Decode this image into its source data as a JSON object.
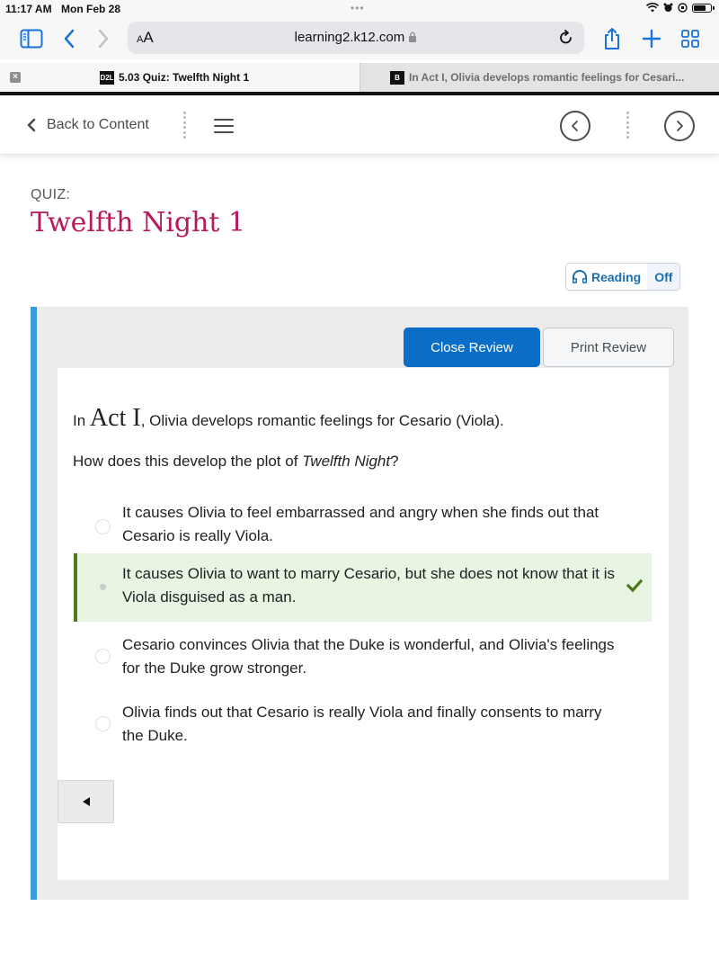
{
  "status_bar": {
    "time": "11:17 AM",
    "date": "Mon Feb 28",
    "dots": "•••"
  },
  "browser": {
    "text_size_small": "A",
    "text_size_large": "A",
    "url": "learning2.k12.com",
    "lock_icon": "🔒",
    "tabs": [
      {
        "favicon": "D2L",
        "title": "5.03 Quiz: Twelfth Night 1",
        "active": true
      },
      {
        "favicon": "B",
        "title": "In Act I, Olivia develops romantic feelings for Cesari...",
        "active": false
      }
    ],
    "tab_close": "×"
  },
  "nav": {
    "back_label": "Back to Content"
  },
  "page": {
    "label": "QUIZ:",
    "title": "Twelfth Night 1",
    "reading_label": "Reading",
    "reading_state": "Off",
    "colors": {
      "title": "#b5195e",
      "accent_bar": "#3a9bd6",
      "primary_button": "#0a6ec7",
      "correct_bar": "#4b7a18",
      "correct_bg": "#e9f5e3"
    }
  },
  "review": {
    "close_label": "Close Review",
    "print_label": "Print Review"
  },
  "question": {
    "intro_prefix": "In",
    "intro_act": "Act I",
    "intro_suffix": ", Olivia develops romantic feelings for Cesario (Viola).",
    "prompt_prefix": "How does this develop the plot of ",
    "prompt_italic": "Twelfth Night",
    "prompt_suffix": "?",
    "options": [
      {
        "text": "It causes Olivia to feel embarrassed and angry when she finds out that Cesario is really Viola.",
        "selected": false,
        "correct": false
      },
      {
        "text": "It causes Olivia to want to marry Cesario, but she does not know that it is Viola disguised as a man.",
        "selected": true,
        "correct": true
      },
      {
        "text": "Cesario convinces Olivia that the Duke is wonderful, and Olivia's feelings for the Duke grow stronger.",
        "selected": false,
        "correct": false
      },
      {
        "text": "Olivia finds out that Cesario is really Viola and finally consents to marry the Duke.",
        "selected": false,
        "correct": false
      }
    ]
  }
}
